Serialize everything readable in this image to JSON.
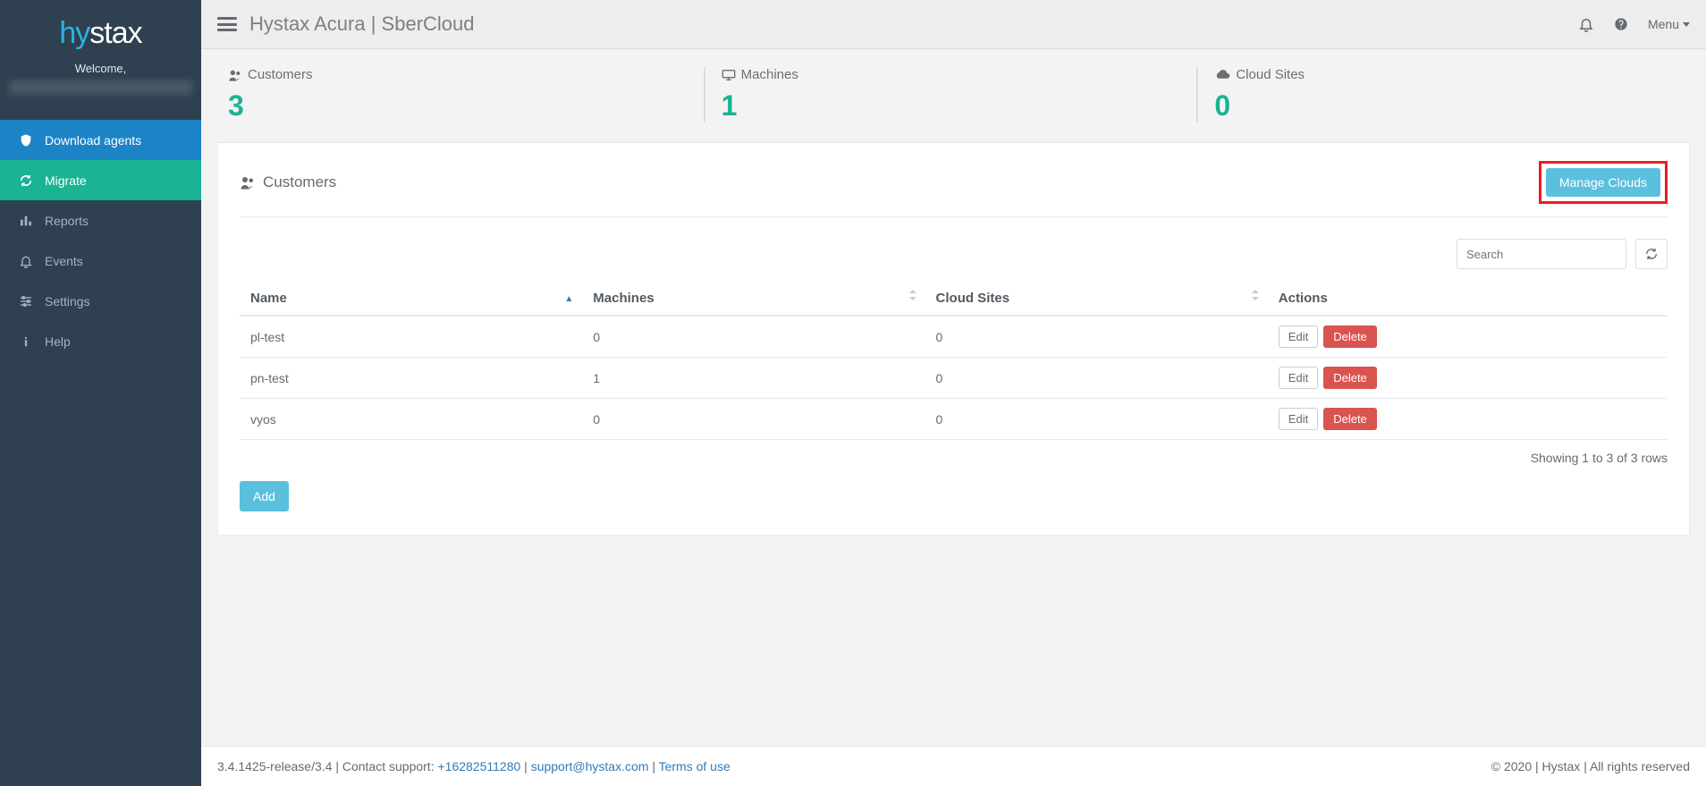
{
  "logo": {
    "part1": "hy",
    "part2": "stax"
  },
  "welcome": {
    "line1": "Welcome,"
  },
  "nav": {
    "download": "Download agents",
    "migrate": "Migrate",
    "reports": "Reports",
    "events": "Events",
    "settings": "Settings",
    "help": "Help"
  },
  "topbar": {
    "title": "Hystax Acura | SberCloud",
    "menu": "Menu"
  },
  "stats": {
    "customers_label": "Customers",
    "customers_value": "3",
    "machines_label": "Machines",
    "machines_value": "1",
    "cloudsites_label": "Cloud Sites",
    "cloudsites_value": "0"
  },
  "panel": {
    "title": "Customers",
    "manage_clouds": "Manage Clouds",
    "search_placeholder": "Search"
  },
  "table": {
    "cols": {
      "name": "Name",
      "machines": "Machines",
      "cloudsites": "Cloud Sites",
      "actions": "Actions"
    },
    "rows": [
      {
        "name": "pl-test",
        "machines": "0",
        "cloudsites": "0"
      },
      {
        "name": "pn-test",
        "machines": "1",
        "cloudsites": "0"
      },
      {
        "name": "vyos",
        "machines": "0",
        "cloudsites": "0"
      }
    ],
    "edit": "Edit",
    "delete": "Delete",
    "info": "Showing 1 to 3 of 3 rows",
    "add": "Add"
  },
  "footer": {
    "left_version": "3.4.1425-release/3.4",
    "left_contact": "Contact support:",
    "left_phone": "+16282511280",
    "left_email": "support@hystax.com",
    "left_terms": "Terms of use",
    "right": "© 2020 | Hystax | All rights reserved"
  }
}
